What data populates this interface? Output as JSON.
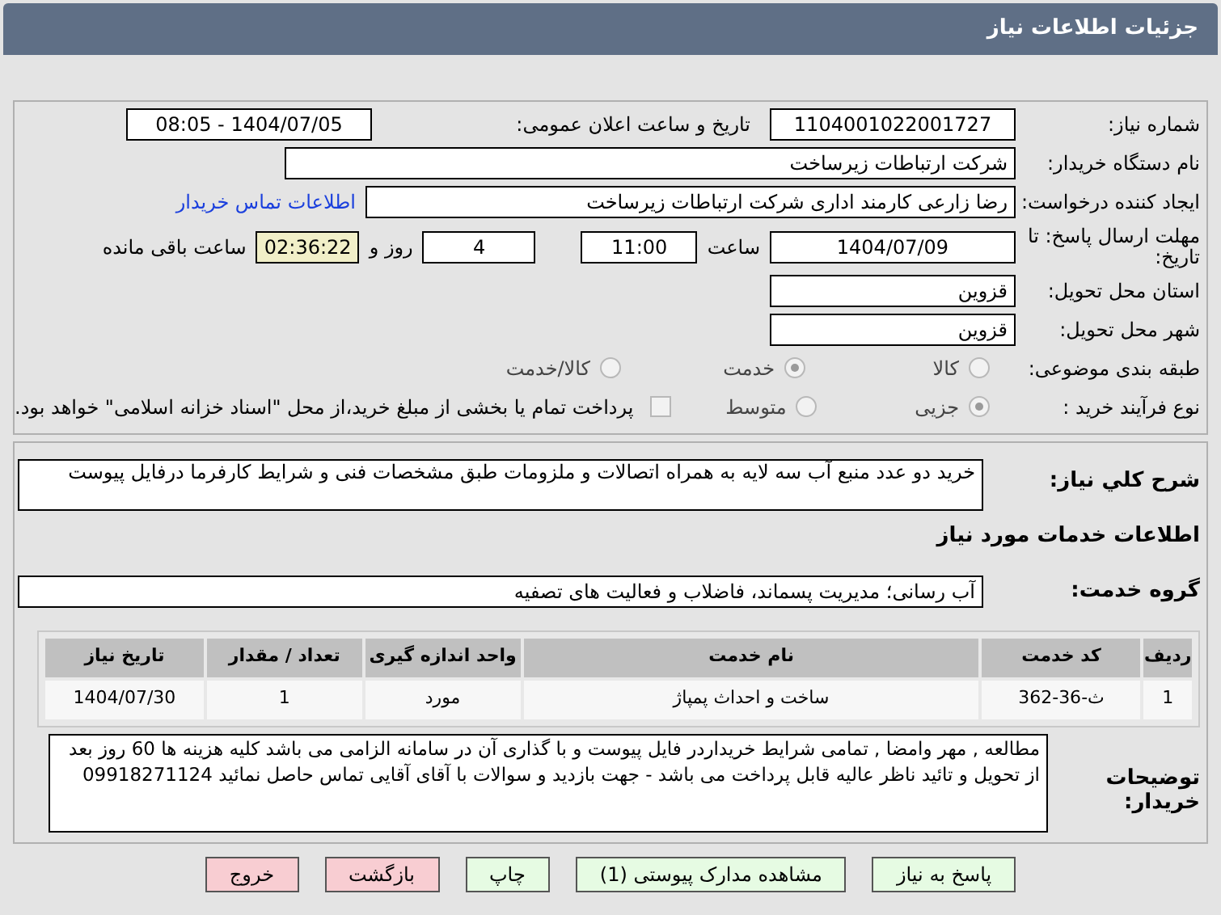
{
  "header": {
    "title": "جزئیات اطلاعات نیاز"
  },
  "need_number": {
    "label": "شماره نیاز:",
    "value": "1104001022001727"
  },
  "announce": {
    "label": "تاریخ و ساعت اعلان عمومی:",
    "value": "1404/07/05 - 08:05"
  },
  "buyer_org": {
    "label": "نام دستگاه خریدار:",
    "value": "شرکت ارتباطات زیرساخت"
  },
  "requester": {
    "label": "ایجاد کننده درخواست:",
    "value": "رضا زارعی کارمند اداری شرکت ارتباطات زیرساخت",
    "link": "اطلاعات تماس خریدار"
  },
  "deadline": {
    "label": "مهلت ارسال پاسخ: تا تاریخ:",
    "date": "1404/07/09",
    "time_label": "ساعت",
    "time": "11:00",
    "days": "4",
    "days_label": "روز و",
    "remaining": "02:36:22",
    "remaining_label": "ساعت باقی مانده"
  },
  "province": {
    "label": "استان محل تحویل:",
    "value": "قزوین"
  },
  "city": {
    "label": "شهر محل تحویل:",
    "value": "قزوین"
  },
  "category": {
    "label": "طبقه بندی موضوعی:",
    "options": [
      {
        "label": "کالا",
        "selected": false
      },
      {
        "label": "خدمت",
        "selected": true
      },
      {
        "label": "کالا/خدمت",
        "selected": false
      }
    ]
  },
  "process": {
    "label": "نوع فرآیند خرید :",
    "options": [
      {
        "label": "جزیی",
        "selected": true
      },
      {
        "label": "متوسط",
        "selected": false
      }
    ],
    "treasury": {
      "label": "پرداخت تمام یا بخشی از مبلغ خرید،از محل \"اسناد خزانه اسلامی\" خواهد بود.",
      "checked": false
    }
  },
  "description": {
    "label": "شرح کلي نياز:",
    "value": "خرید  دو عدد منبع آب سه لایه  به همراه اتصالات و ملزومات طبق مشخصات فنی و شرایط کارفرما درفایل پیوست"
  },
  "services_heading": "اطلاعات خدمات مورد نیاز",
  "service_group": {
    "label": "گروه خدمت:",
    "value": "آب رسانی؛ مدیریت پسماند، فاضلاب و فعالیت های تصفیه"
  },
  "table": {
    "columns": [
      "ردیف",
      "کد خدمت",
      "نام خدمت",
      "واحد اندازه گیری",
      "تعداد / مقدار",
      "تاریخ نیاز"
    ],
    "rows": [
      [
        "1",
        "ث-36-362",
        "ساخت و احداث پمپاژ",
        "مورد",
        "1",
        "1404/07/30"
      ]
    ]
  },
  "notes": {
    "label": "توضیحات خریدار:",
    "value": "مطالعه , مهر وامضا , تمامی شرایط خریداردر فایل پیوست و با گذاری آن در سامانه الزامی می باشد کلیه هزینه ها 60 روز بعد از تحویل و تائید ناظر عالیه قابل پرداخت می باشد - جهت بازدید و سوالات با آقای آقایی تماس حاصل نمائید 09918271124"
  },
  "buttons": [
    {
      "label": "پاسخ به نیاز",
      "kind": "normal"
    },
    {
      "label": "مشاهده مدارک پیوستی (1)",
      "kind": "normal"
    },
    {
      "label": "چاپ",
      "kind": "normal"
    },
    {
      "label": "بازگشت",
      "kind": "danger"
    },
    {
      "label": "خروج",
      "kind": "danger"
    }
  ]
}
